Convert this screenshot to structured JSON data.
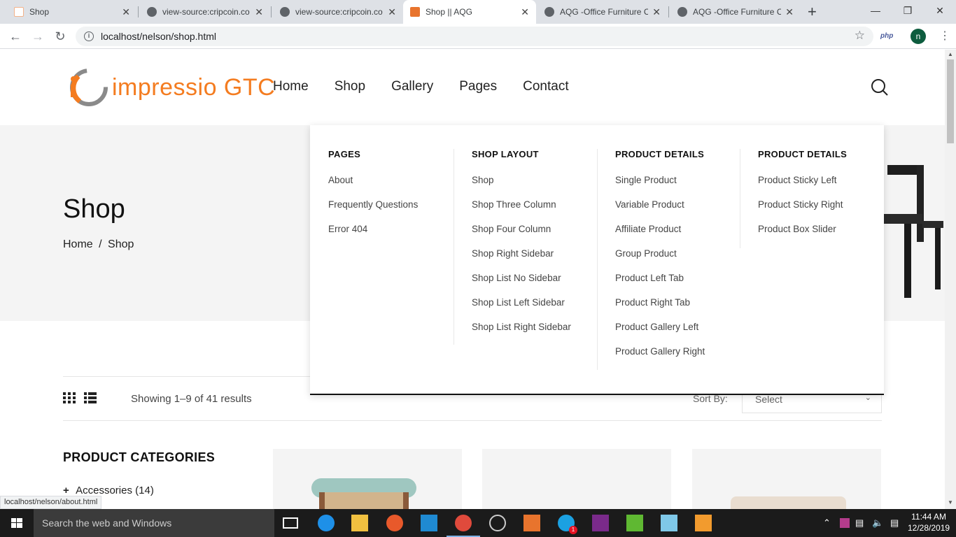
{
  "browser": {
    "tabs": [
      {
        "title": "Shop",
        "active": false
      },
      {
        "title": "view-source:cripcoin.co",
        "active": false
      },
      {
        "title": "view-source:cripcoin.co",
        "active": false
      },
      {
        "title": "Shop || AQG",
        "active": true
      },
      {
        "title": "AQG -Office Furniture C",
        "active": false
      },
      {
        "title": "AQG -Office Furniture C",
        "active": false
      }
    ],
    "close_glyph": "✕",
    "new_tab": "+",
    "url": "localhost/nelson/shop.html",
    "php_ext": "php",
    "profile_initial": "n",
    "status_link": "localhost/nelson/about.html"
  },
  "site": {
    "logo_text": "impressio GTC",
    "nav": [
      "Home",
      "Shop",
      "Gallery",
      "Pages",
      "Contact"
    ],
    "page_title": "Shop",
    "breadcrumb": {
      "home": "Home",
      "sep": "/",
      "current": "Shop"
    }
  },
  "mega_menu": {
    "columns": [
      {
        "heading": "PAGES",
        "links": [
          "About",
          "Frequently Questions",
          "Error 404"
        ]
      },
      {
        "heading": "SHOP LAYOUT",
        "links": [
          "Shop",
          "Shop Three Column",
          "Shop Four Column",
          "Shop Right Sidebar",
          "Shop List No Sidebar",
          "Shop List Left Sidebar",
          "Shop List Right Sidebar"
        ]
      },
      {
        "heading": "PRODUCT DETAILS",
        "links": [
          "Single Product",
          "Variable Product",
          "Affiliate Product",
          "Group Product",
          "Product Left Tab",
          "Product Right Tab",
          "Product Gallery Left",
          "Product Gallery Right"
        ]
      },
      {
        "heading": "PRODUCT DETAILS",
        "links": [
          "Product Sticky Left",
          "Product Sticky Right",
          "Product Box Slider"
        ]
      }
    ]
  },
  "toolbar": {
    "showing": "Showing 1–9 of 41 results",
    "sort_label": "Sort By:",
    "sort_value": "Select"
  },
  "sidebar": {
    "heading": "PRODUCT CATEGORIES",
    "first_item": "Accessories (14)",
    "first_item_toggle": "+"
  },
  "taskbar": {
    "search_placeholder": "Search the web and Windows",
    "time": "11:44 AM",
    "date": "12/28/2019",
    "skype_badge": "1"
  },
  "colors": {
    "brand": "#f47c20",
    "accent_tab_bar": "#dee1e6",
    "taskbar": "#1b1b1b"
  }
}
